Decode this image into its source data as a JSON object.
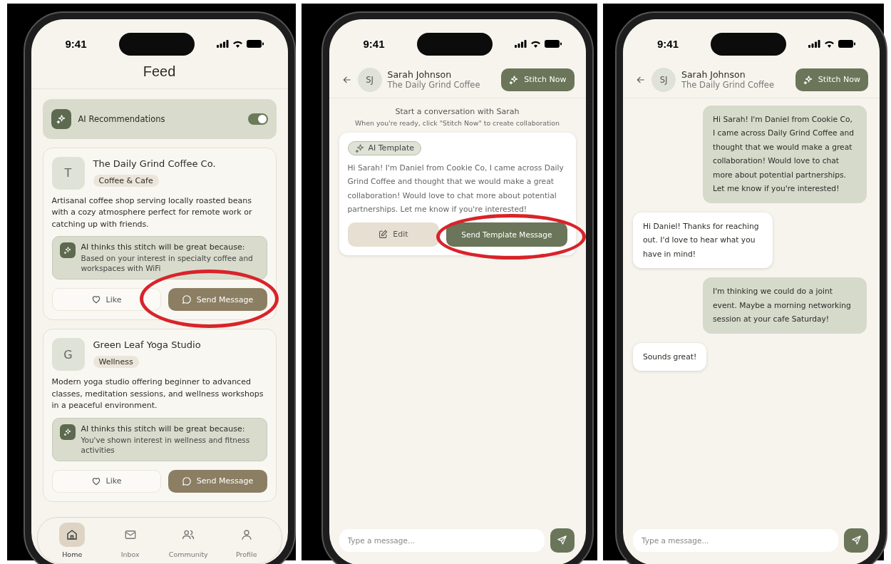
{
  "screens": [
    {
      "kind": "feed",
      "time": "9:41",
      "title": "Feed",
      "ai_toggle": {
        "label": "AI Recommendations",
        "on": true
      },
      "cards": [
        {
          "initial": "T",
          "name": "The Daily Grind Coffee Co.",
          "category": "Coffee & Cafe",
          "description": "Artisanal coffee shop serving locally roasted beans with a cozy atmosphere perfect for remote work or catching up with friends.",
          "reason_title": "AI thinks this stitch will be great because:",
          "reason": "Based on your interest in specialty coffee and workspaces with WiFi",
          "like": "Like",
          "send": "Send Message",
          "highlighted": true
        },
        {
          "initial": "G",
          "name": "Green Leaf Yoga Studio",
          "category": "Wellness",
          "description": "Modern yoga studio offering beginner to advanced classes, meditation sessions, and wellness workshops in a peaceful environment.",
          "reason_title": "AI thinks this stitch will be great because:",
          "reason": "You've shown interest in wellness and fitness activities",
          "like": "Like",
          "send": "Send Message",
          "highlighted": false
        }
      ],
      "nav": [
        {
          "label": "Home",
          "selected": true
        },
        {
          "label": "Inbox",
          "selected": false
        },
        {
          "label": "Community",
          "selected": false
        },
        {
          "label": "Profile",
          "selected": false
        }
      ]
    },
    {
      "kind": "chat",
      "time": "9:41",
      "contact": {
        "initials": "SJ",
        "name": "Sarah Johnson",
        "business": "The Daily Grind Coffee"
      },
      "action": "Stitch Now",
      "intro": "Start a conversation with Sarah",
      "hint": "When you're ready, click \"Stitch Now\" to create collaboration",
      "template": {
        "badge": "AI Template",
        "text": "Hi Sarah! I'm Daniel from Cookie Co, I came across Daily Grind Coffee and thought that we would make a great collaboration! Would love to chat more about potential partnerships. Let me know if you're interested!",
        "edit": "Edit",
        "send": "Send Template Message",
        "highlighted": true
      },
      "placeholder": "Type a message..."
    },
    {
      "kind": "chat",
      "time": "9:41",
      "contact": {
        "initials": "SJ",
        "name": "Sarah Johnson",
        "business": "The Daily Grind Coffee"
      },
      "action": "Stitch Now",
      "messages": [
        {
          "kind": "sent",
          "text": "Hi Sarah! I'm Daniel from Cookie Co, I came across Daily Grind Coffee and thought that we would make a great collaboration! Would love to chat more about potential partnerships. Let me know if you're interested!"
        },
        {
          "kind": "received",
          "text": "Hi Daniel! Thanks for reaching out. I'd love to hear what you have in mind!"
        },
        {
          "kind": "sent",
          "text": "I'm thinking we could do a joint event. Maybe a morning networking session at your cafe Saturday!"
        },
        {
          "kind": "received",
          "text": "Sounds great!"
        }
      ],
      "placeholder": "Type a message..."
    }
  ]
}
